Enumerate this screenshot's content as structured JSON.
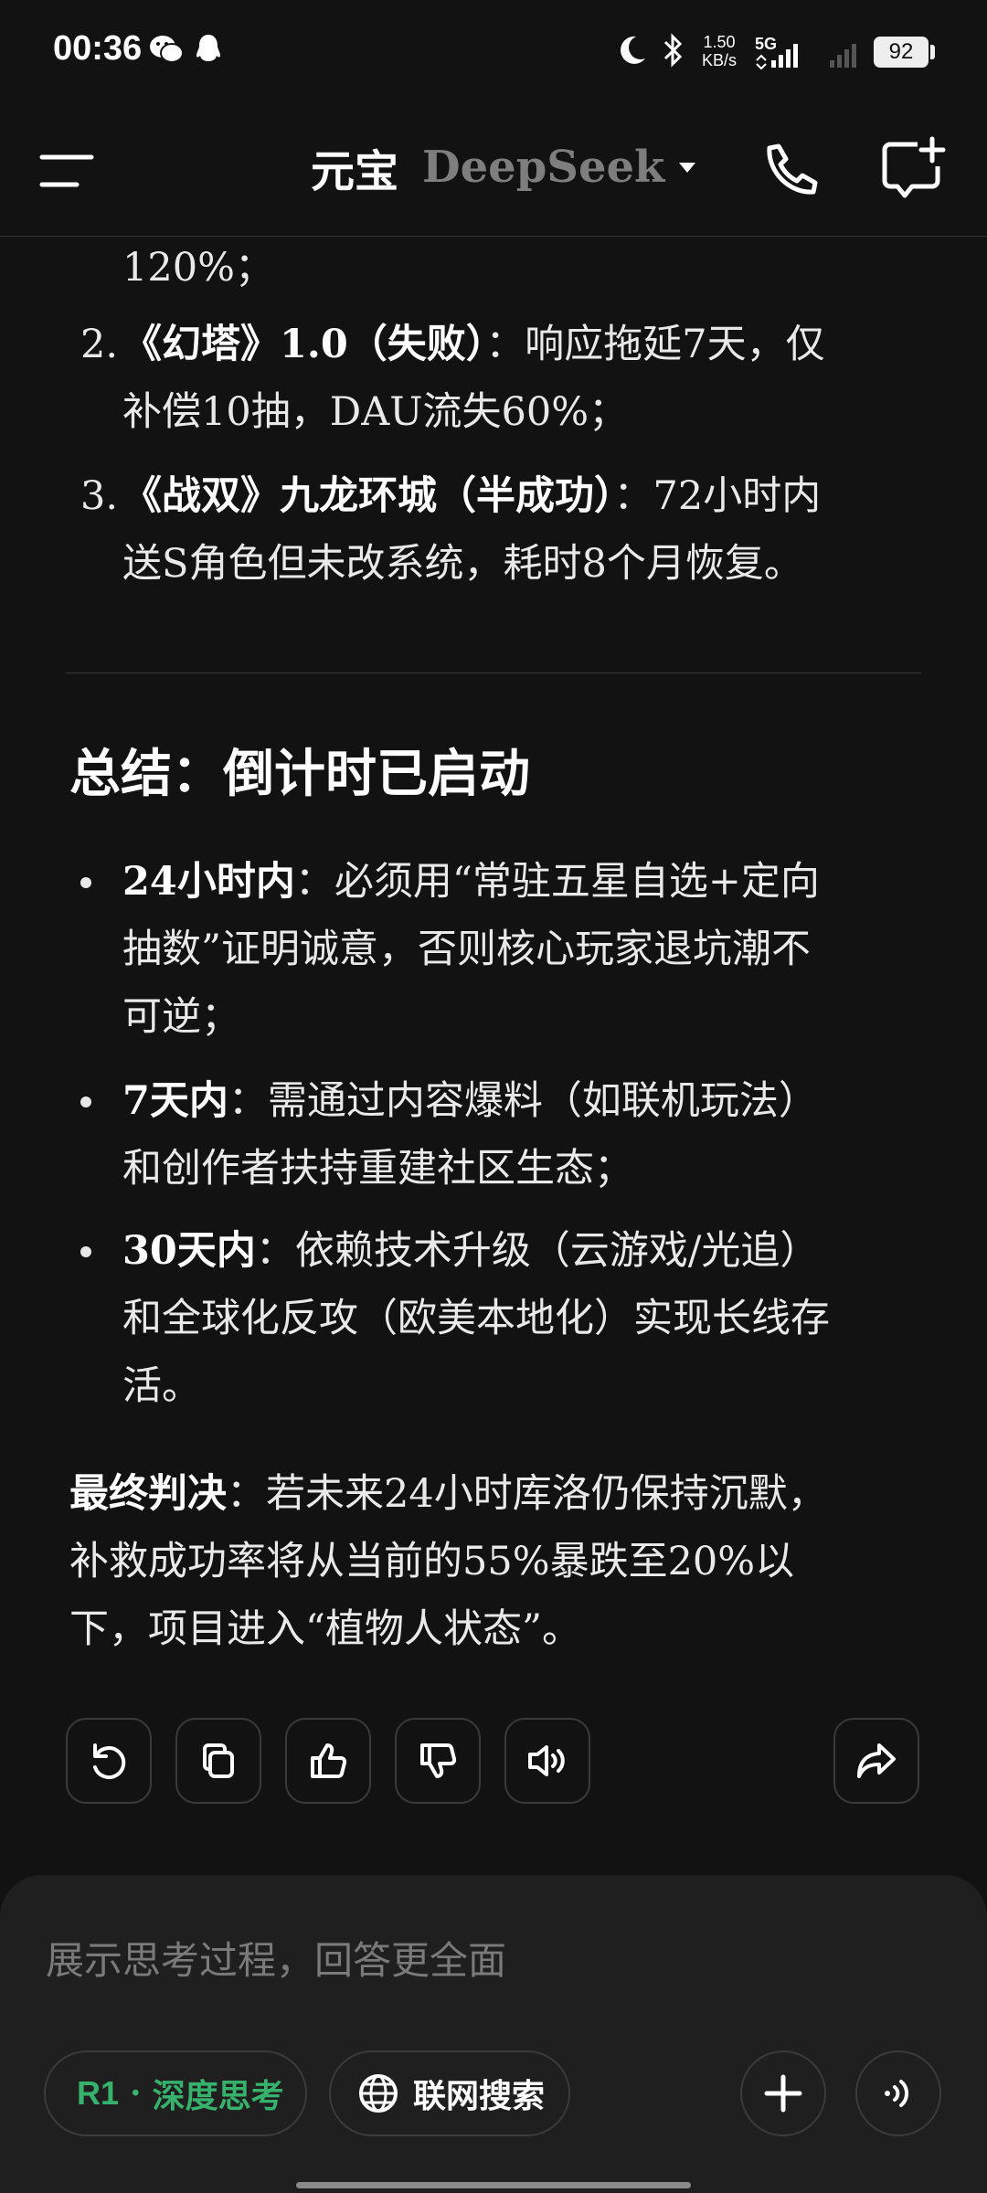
{
  "status_bar": {
    "time": "00:36",
    "net_speed_value": "1.50",
    "net_speed_unit": "KB/s",
    "network_type": "5G",
    "battery": "92"
  },
  "header": {
    "app_name": "元宝",
    "model_name": "DeepSeek"
  },
  "content": {
    "partial_line": "120%；",
    "cases": [
      {
        "num": "2.",
        "title": "《幻塔》1.0（失败）",
        "line1": "：响应拖延7天，仅",
        "line2": "补偿10抽，DAU流失60%；"
      },
      {
        "num": "3.",
        "title": "《战双》九龙环城（半成功）",
        "line1": "：72小时内",
        "line2": "送S角色但未改系统，耗时8个月恢复。"
      }
    ],
    "summary_heading": "总结：倒计时已启动",
    "bullets": [
      {
        "label": "24小时内",
        "lines": [
          "：必须用“常驻五星自选+定向",
          "抽数”证明诚意，否则核心玩家退坑潮不",
          "可逆；"
        ]
      },
      {
        "label": "7天内",
        "lines": [
          "：需通过内容爆料（如联机玩法）",
          "和创作者扶持重建社区生态；"
        ]
      },
      {
        "label": "30天内",
        "lines": [
          "：依赖技术升级（云游戏/光追）",
          "和全球化反攻（欧美本地化）实现长线存",
          "活。"
        ]
      }
    ],
    "verdict": {
      "label": "最终判决",
      "lines": [
        "：若未来24小时库洛仍保持沉默，",
        "补救成功率将从当前的55%暴跌至20%以",
        "下，项目进入“植物人状态”。"
      ]
    }
  },
  "input": {
    "placeholder": "展示思考过程，回答更全面",
    "deep_think_prefix": "R1",
    "deep_think_sep": "·",
    "deep_think_label": "深度思考",
    "web_search_label": "联网搜索"
  },
  "colors": {
    "background": "#121212",
    "accent_green": "#37b26c",
    "panel": "#1f1f1f"
  },
  "icons": [
    "wechat-icon",
    "qq-icon",
    "moon-icon",
    "bluetooth-icon",
    "signal-icon",
    "menu-icon",
    "chevron-down-icon",
    "phone-icon",
    "new-chat-icon",
    "regenerate-icon",
    "copy-icon",
    "thumbs-up-icon",
    "thumbs-down-icon",
    "speaker-icon",
    "share-icon",
    "globe-icon",
    "plus-icon",
    "voice-icon"
  ]
}
